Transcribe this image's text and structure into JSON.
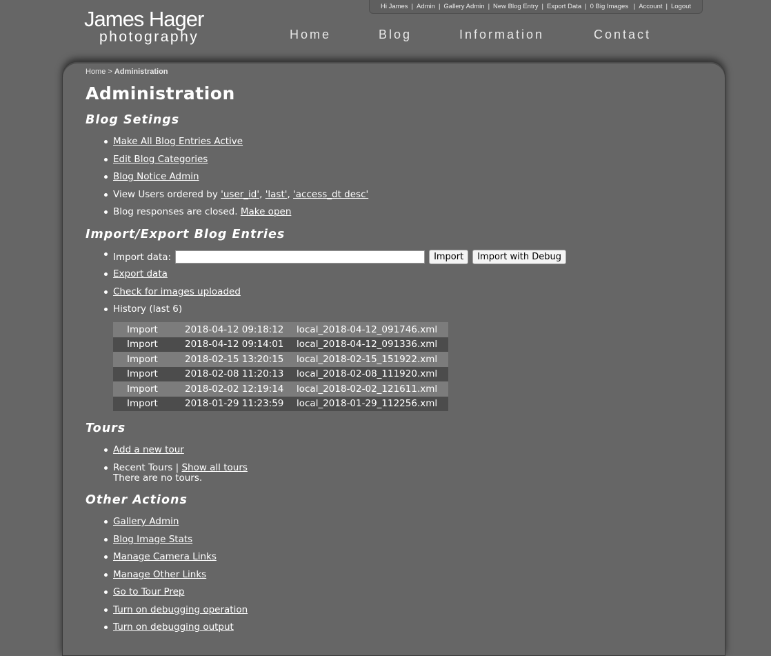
{
  "userbar": {
    "items": [
      "Hi James",
      "Admin",
      "Gallery Admin",
      "New Blog Entry",
      "Export Data",
      "0 Big Images",
      "Account",
      "Logout"
    ]
  },
  "logo": {
    "line1": "James Hager",
    "line2": "photography"
  },
  "nav": {
    "items": [
      "Home",
      "Blog",
      "Information",
      "Contact"
    ]
  },
  "breadcrumb": {
    "home": "Home",
    "separator": ">",
    "current": "Administration"
  },
  "page_title": "Administration",
  "blog_settings": {
    "heading": "Blog Setings",
    "make_active": "Make All Blog Entries Active",
    "edit_categories": "Edit Blog Categories",
    "notice_admin": "Blog Notice Admin",
    "view_users_prefix": "View Users ordered by ",
    "order_user_id": "'user_id'",
    "order_last": "'last'",
    "order_access": "'access_dt desc'",
    "responses_text": "Blog responses are closed. ",
    "make_open": "Make open"
  },
  "import_export": {
    "heading": "Import/Export Blog Entries",
    "import_label": "Import data:",
    "import_value": "",
    "import_button": "Import",
    "import_debug_button": "Import with Debug",
    "export_data": "Export data",
    "check_images": "Check for images uploaded",
    "history_label": "History (last 6)",
    "history": [
      {
        "type": "Import",
        "date": "2018-04-12 09:18:12",
        "file": "local_2018-04-12_091746.xml"
      },
      {
        "type": "Import",
        "date": "2018-04-12 09:14:01",
        "file": "local_2018-04-12_091336.xml"
      },
      {
        "type": "Import",
        "date": "2018-02-15 13:20:15",
        "file": "local_2018-02-15_151922.xml"
      },
      {
        "type": "Import",
        "date": "2018-02-08 11:20:13",
        "file": "local_2018-02-08_111920.xml"
      },
      {
        "type": "Import",
        "date": "2018-02-02 12:19:14",
        "file": "local_2018-02-02_121611.xml"
      },
      {
        "type": "Import",
        "date": "2018-01-29 11:23:59",
        "file": "local_2018-01-29_112256.xml"
      }
    ]
  },
  "tours": {
    "heading": "Tours",
    "add_new": "Add a new tour",
    "recent_label": "Recent Tours | ",
    "show_all": "Show all tours",
    "no_tours": "There are no tours."
  },
  "other_actions": {
    "heading": "Other Actions",
    "items": [
      "Gallery Admin",
      "Blog Image Stats",
      "Manage Camera Links",
      "Manage Other Links",
      "Go to Tour Prep",
      "Turn on debugging operation",
      "Turn on debugging output"
    ]
  },
  "colors": {
    "background": "#666666",
    "text": "#ffffff",
    "row_light": "#7c7c7c",
    "row_dark": "#4c4c4c"
  }
}
